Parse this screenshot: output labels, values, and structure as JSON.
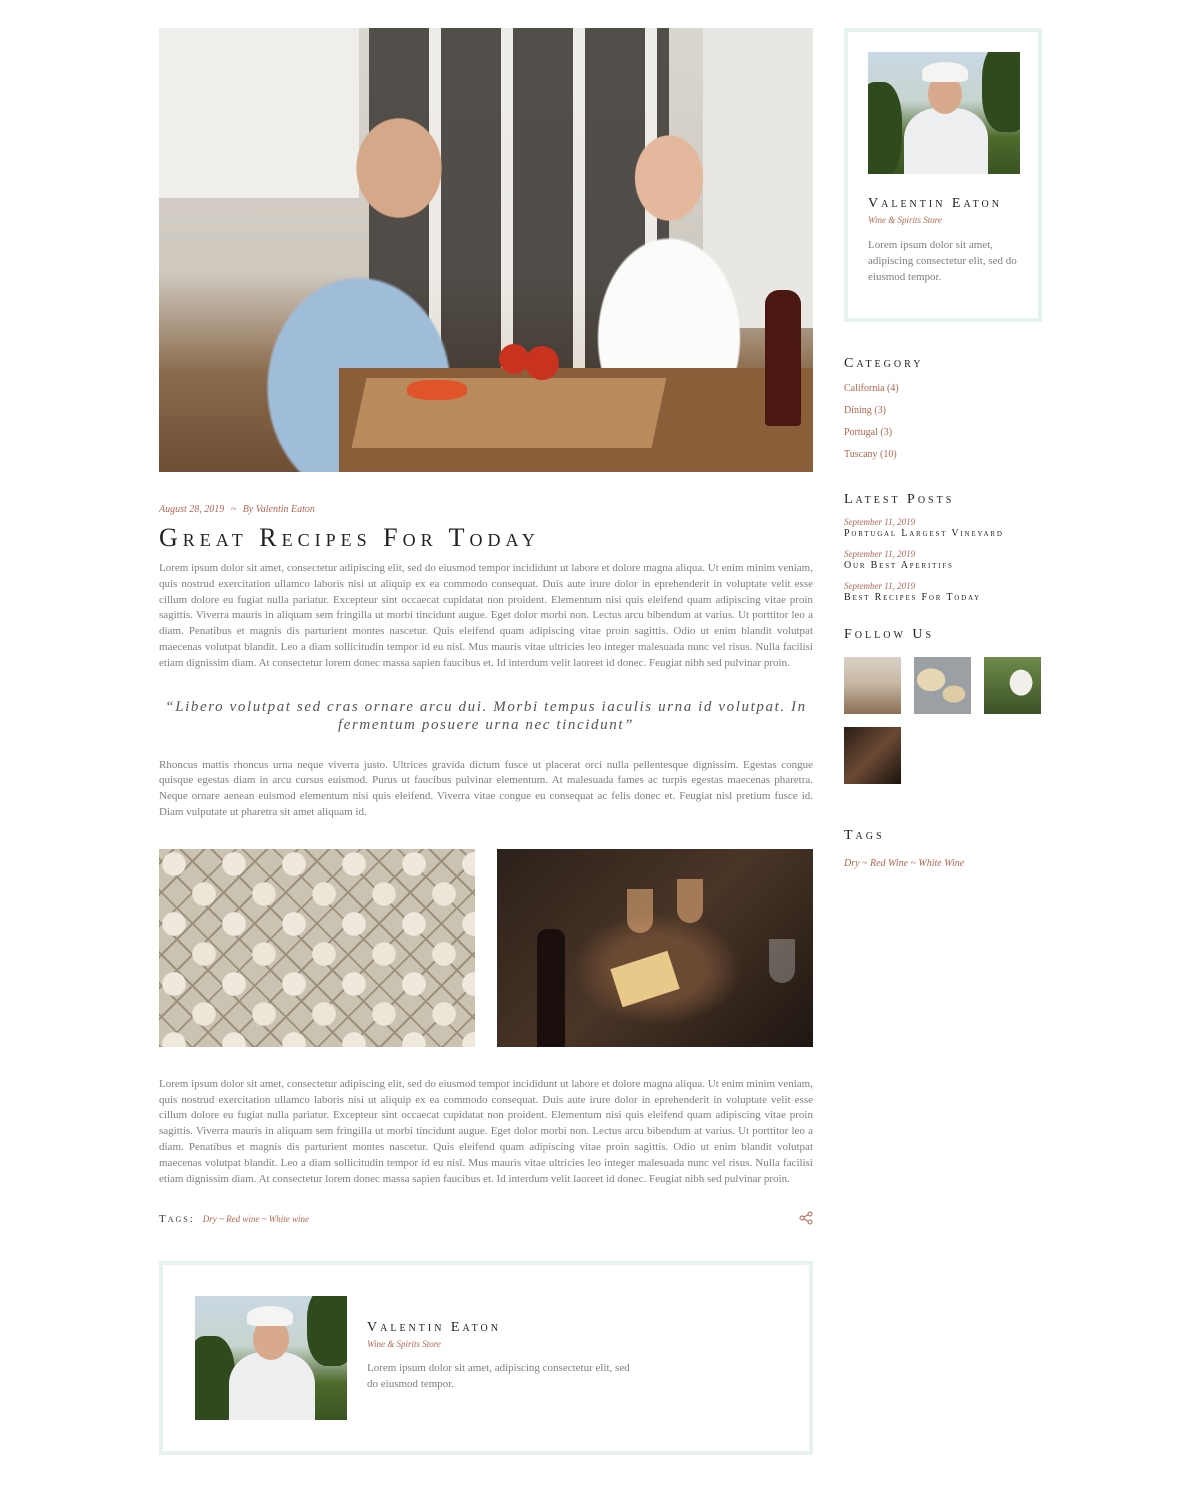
{
  "post": {
    "date": "August 28, 2019",
    "separator": "~",
    "byline": "By Valentin Eaton",
    "title": "Great Recipes For Today",
    "paragraph1": "Lorem ipsum dolor sit amet, consectetur adipiscing elit, sed do eiusmod tempor incididunt ut labore et dolore magna aliqua. Ut enim minim veniam, quis nostrud exercitation ullamco laboris nisi ut aliquip ex ea commodo consequat. Duis aute irure dolor in eprehenderit in voluptate velit esse cillum dolore eu fugiat nulla pariatur. Excepteur sint occaecat cupidatat non proident. Elementum nisi quis eleifend quam adipiscing vitae proin sagittis. Viverra mauris in aliquam sem fringilla ut morbi tincidunt augue. Eget dolor morbi non. Lectus arcu bibendum at varius. Ut porttitor leo a diam. Penatibus et magnis dis parturient montes nascetur. Quis eleifend quam adipiscing vitae proin sagittis. Odio ut enim blandit volutpat maecenas volutpat blandit. Leo a diam sollicitudin tempor id eu nisl. Mus mauris vitae ultricies leo integer malesuada nunc vel risus. Nulla facilisi etiam dignissim diam. At consectetur lorem donec massa sapien faucibus et. Id interdum velit laoreet id donec. Feugiat nibh sed pulvinar proin.",
    "quote": "“Libero volutpat sed cras ornare arcu dui. Morbi tempus iaculis urna id volutpat. In fermentum posuere urna nec tincidunt”",
    "paragraph2": "Rhoncus mattis rhoncus urna neque viverra justo. Ultrices gravida dictum fusce ut placerat orci nulla pellentesque dignissim. Egestas congue quisque egestas diam in arcu cursus euismod. Purus ut faucibus pulvinar elementum. At malesuada fames ac turpis egestas maecenas pharetra. Neque ornare aenean euismod elementum nisi quis eleifend. Viverra vitae congue eu consequat ac felis donec et. Feugiat nisl pretium fusce id. Diam vulputate ut pharetra sit amet aliquam id.",
    "paragraph3": "Lorem ipsum dolor sit amet, consectetur adipiscing elit, sed do eiusmod tempor incididunt ut labore et dolore magna aliqua. Ut enim minim veniam, quis nostrud exercitation ullamco laboris nisi ut aliquip ex ea commodo consequat. Duis aute irure dolor in eprehenderit in voluptate velit esse cillum dolore eu fugiat nulla pariatur. Excepteur sint occaecat cupidatat non proident. Elementum nisi quis eleifend quam adipiscing vitae proin sagittis. Viverra mauris in aliquam sem fringilla ut morbi tincidunt augue. Eget dolor morbi non. Lectus arcu bibendum at varius. Ut porttitor leo a diam. Penatibus et magnis dis parturient montes nascetur. Quis eleifend quam adipiscing vitae proin sagittis. Odio ut enim blandit volutpat maecenas volutpat blandit. Leo a diam sollicitudin tempor id eu nisl. Mus mauris vitae ultricies leo integer malesuada nunc vel risus. Nulla facilisi etiam dignissim diam. At consectetur lorem donec massa sapien faucibus et. Id interdum velit laoreet id donec. Feugiat nibh sed pulvinar proin.",
    "tags_label": "Tags:",
    "tags": "Dry ~ Red wine ~ White wine",
    "share_icon": "share-icon"
  },
  "author": {
    "name": "Valentin Eaton",
    "role": "Wine & Spirits Store",
    "bio_sidebar": "Lorem ipsum dolor sit amet, adipiscing consectetur elit, sed do eiusmod tempor.",
    "bio_box": "Lorem ipsum dolor sit amet, adipiscing consectetur elit, sed do eiusmod tempor."
  },
  "sidebar": {
    "category_title": "Category",
    "categories": [
      "California (4)",
      "Dining (3)",
      "Portugal (3)",
      "Tuscany (10)"
    ],
    "latest_title": "Latest Posts",
    "latest": [
      {
        "date": "September 11, 2019",
        "title": "Portugal Largest Vineyard"
      },
      {
        "date": "September 11, 2019",
        "title": "Our Best Aperitifs"
      },
      {
        "date": "September 11, 2019",
        "title": "Best Recipes For Today"
      }
    ],
    "follow_title": "Follow Us",
    "tags_title": "Tags",
    "tags": "Dry ~ Red Wine ~ White Wine"
  },
  "colors": {
    "accent": "#b6664e",
    "border": "#e6f2ef",
    "heading": "#222222",
    "body": "#7e7e7e"
  }
}
